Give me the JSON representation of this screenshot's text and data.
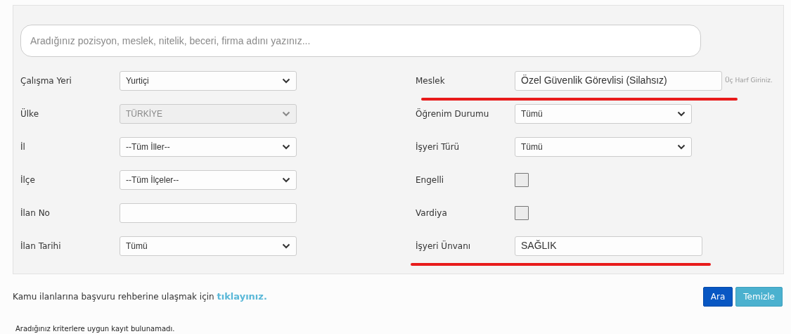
{
  "search": {
    "placeholder": "Aradığınız pozisyon, meslek, nitelik, beceri, firma adını yazınız..."
  },
  "left_fields": [
    {
      "label": "Çalışma Yeri",
      "kind": "select",
      "value": "Yurtiçi",
      "disabled": false
    },
    {
      "label": "Ülke",
      "kind": "select",
      "value": "TÜRKİYE",
      "disabled": true
    },
    {
      "label": "İl",
      "kind": "select",
      "value": "--Tüm İller--",
      "disabled": false
    },
    {
      "label": "İlçe",
      "kind": "select",
      "value": "--Tüm İlçeler--",
      "disabled": false
    },
    {
      "label": "İlan No",
      "kind": "input",
      "disabled": false
    },
    {
      "label": "İlan Tarihi",
      "kind": "select",
      "value": "Tümü",
      "disabled": false
    }
  ],
  "right_fields": [
    {
      "label": "Meslek",
      "kind": "input",
      "value": "Özel Güvenlik Görevlisi (Silahsız)",
      "hint": "Üç Harf Giriniz.",
      "underlined": true
    },
    {
      "label": "Öğrenim Durumu",
      "kind": "select",
      "value": "Tümü",
      "underlined": false
    },
    {
      "label": "İşyeri Türü",
      "kind": "select",
      "value": "Tümü",
      "underlined": false
    },
    {
      "label": "Engelli",
      "kind": "checkbox",
      "checked": false,
      "underlined": false
    },
    {
      "label": "Vardiya",
      "kind": "checkbox",
      "checked": false,
      "underlined": false
    },
    {
      "label": "İşyeri Ünvanı",
      "kind": "input",
      "value": "SAĞLIK",
      "underlined": true
    }
  ],
  "guide": {
    "text": "Kamu ilanlarına başvuru rehberine ulaşmak için",
    "link": "tıklayınız."
  },
  "buttons": [
    {
      "label": "Ara",
      "kind": "primary"
    },
    {
      "label": "Temizle",
      "kind": "secondary"
    }
  ],
  "message": "Aradığınız kriterlere uygun kayıt bulunamadı."
}
